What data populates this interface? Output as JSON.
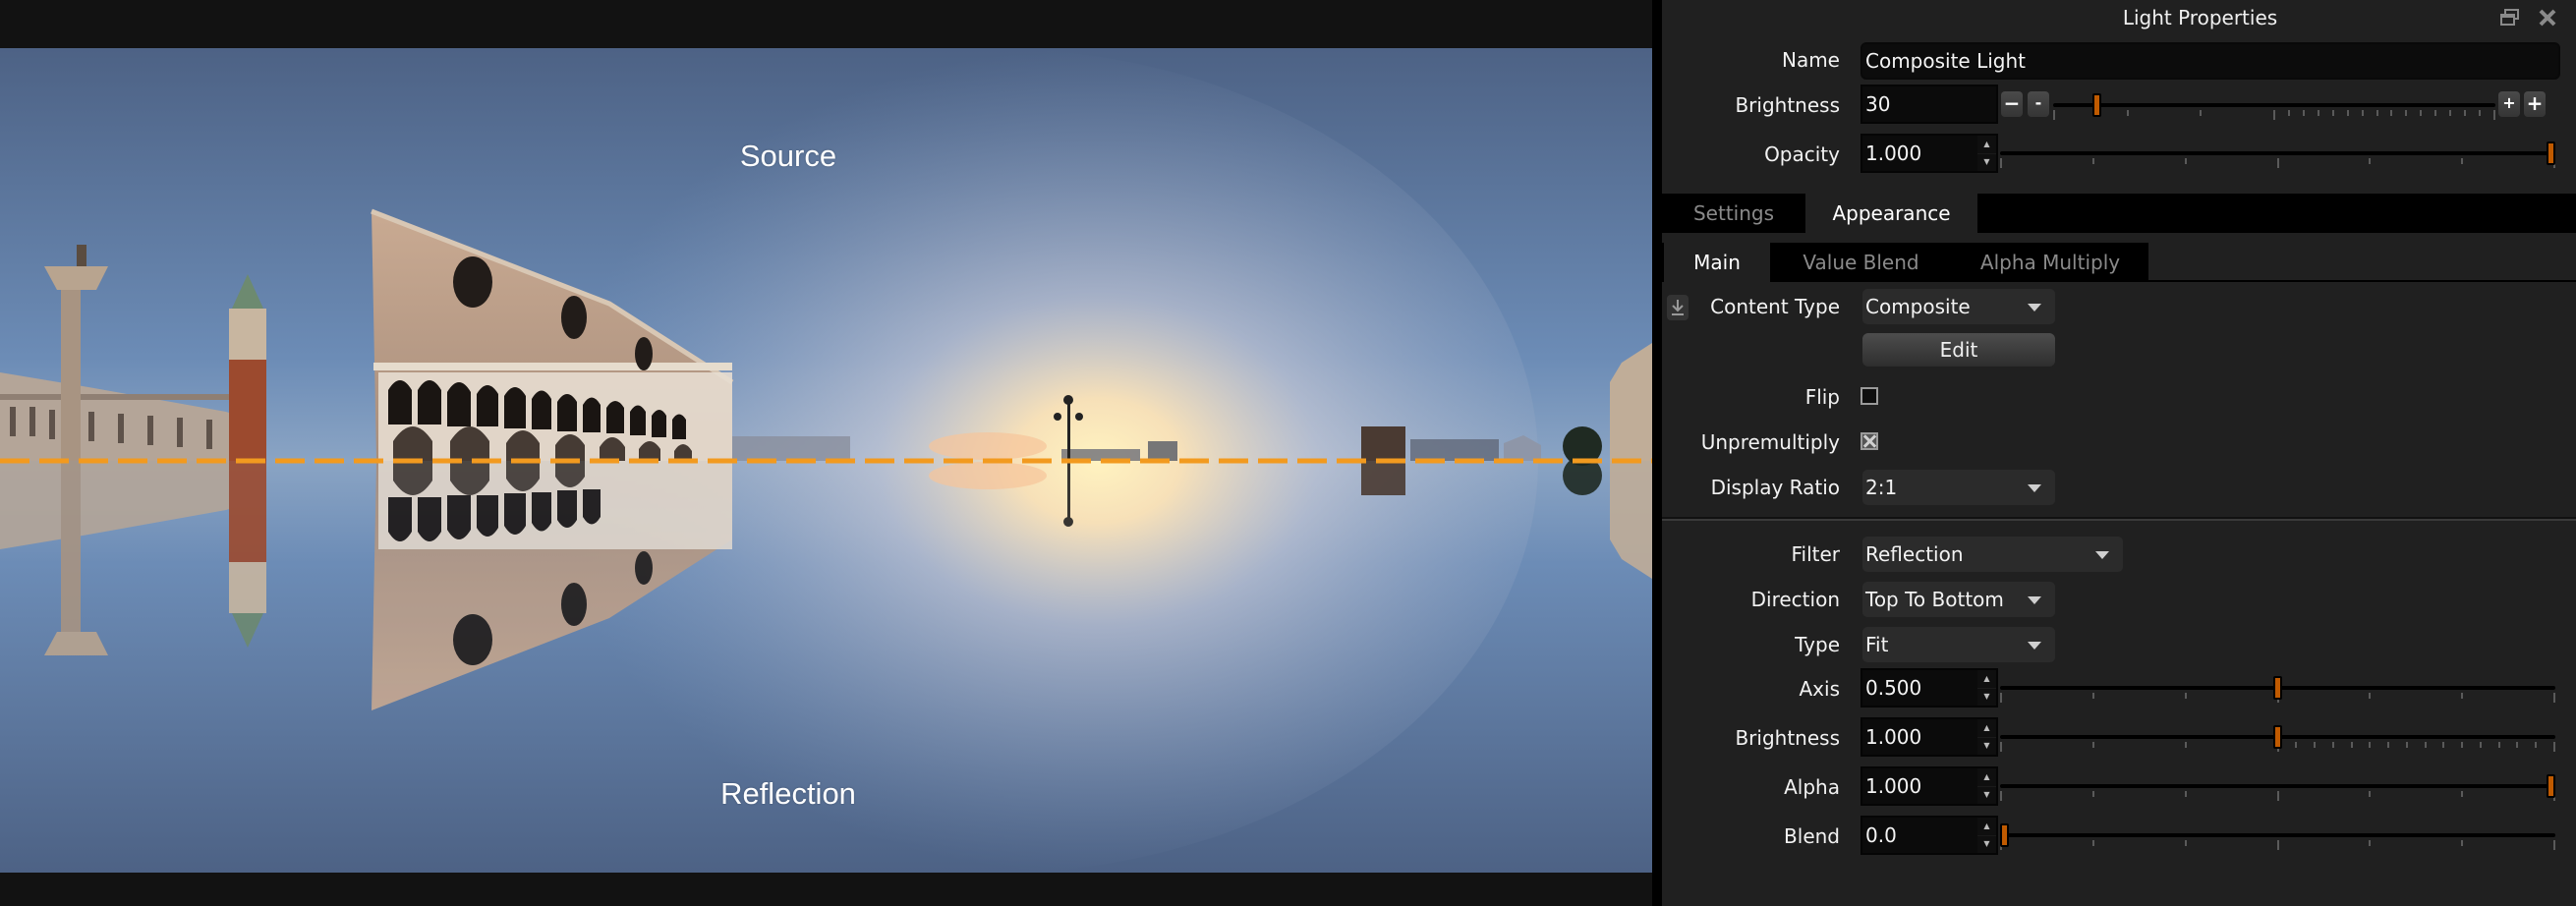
{
  "viewport": {
    "overlay_top_label": "Source",
    "overlay_bottom_label": "Reflection",
    "horizon_color": "#f29a1f"
  },
  "panel": {
    "title": "Light Properties",
    "icons": {
      "float": "float-window-icon",
      "close": "close-icon"
    },
    "name": {
      "label": "Name",
      "value": "Composite Light"
    },
    "brightness": {
      "label": "Brightness",
      "value": "30",
      "slider_fraction": 0.09
    },
    "opacity": {
      "label": "Opacity",
      "value": "1.000",
      "slider_fraction": 1.0
    },
    "tabs": [
      {
        "label": "Settings",
        "active": false
      },
      {
        "label": "Appearance",
        "active": true
      }
    ],
    "subtabs": [
      {
        "label": "Main",
        "active": true
      },
      {
        "label": "Value Blend",
        "active": false
      },
      {
        "label": "Alpha Multiply",
        "active": false
      }
    ],
    "content_type": {
      "label": "Content Type",
      "value": "Composite"
    },
    "edit_button": "Edit",
    "flip": {
      "label": "Flip",
      "checked": false
    },
    "unpremultiply": {
      "label": "Unpremultiply",
      "checked": true
    },
    "display_ratio": {
      "label": "Display Ratio",
      "value": "2:1"
    },
    "filter": {
      "label": "Filter",
      "value": "Reflection"
    },
    "direction": {
      "label": "Direction",
      "value": "Top To Bottom"
    },
    "type": {
      "label": "Type",
      "value": "Fit"
    },
    "axis": {
      "label": "Axis",
      "value": "0.500",
      "slider_fraction": 0.5
    },
    "filter_brightness": {
      "label": "Brightness",
      "value": "1.000",
      "slider_fraction": 0.5
    },
    "alpha": {
      "label": "Alpha",
      "value": "1.000",
      "slider_fraction": 1.0
    },
    "blend": {
      "label": "Blend",
      "value": "0.0",
      "slider_fraction": 0.0
    },
    "accent_color": "#c05a00"
  }
}
